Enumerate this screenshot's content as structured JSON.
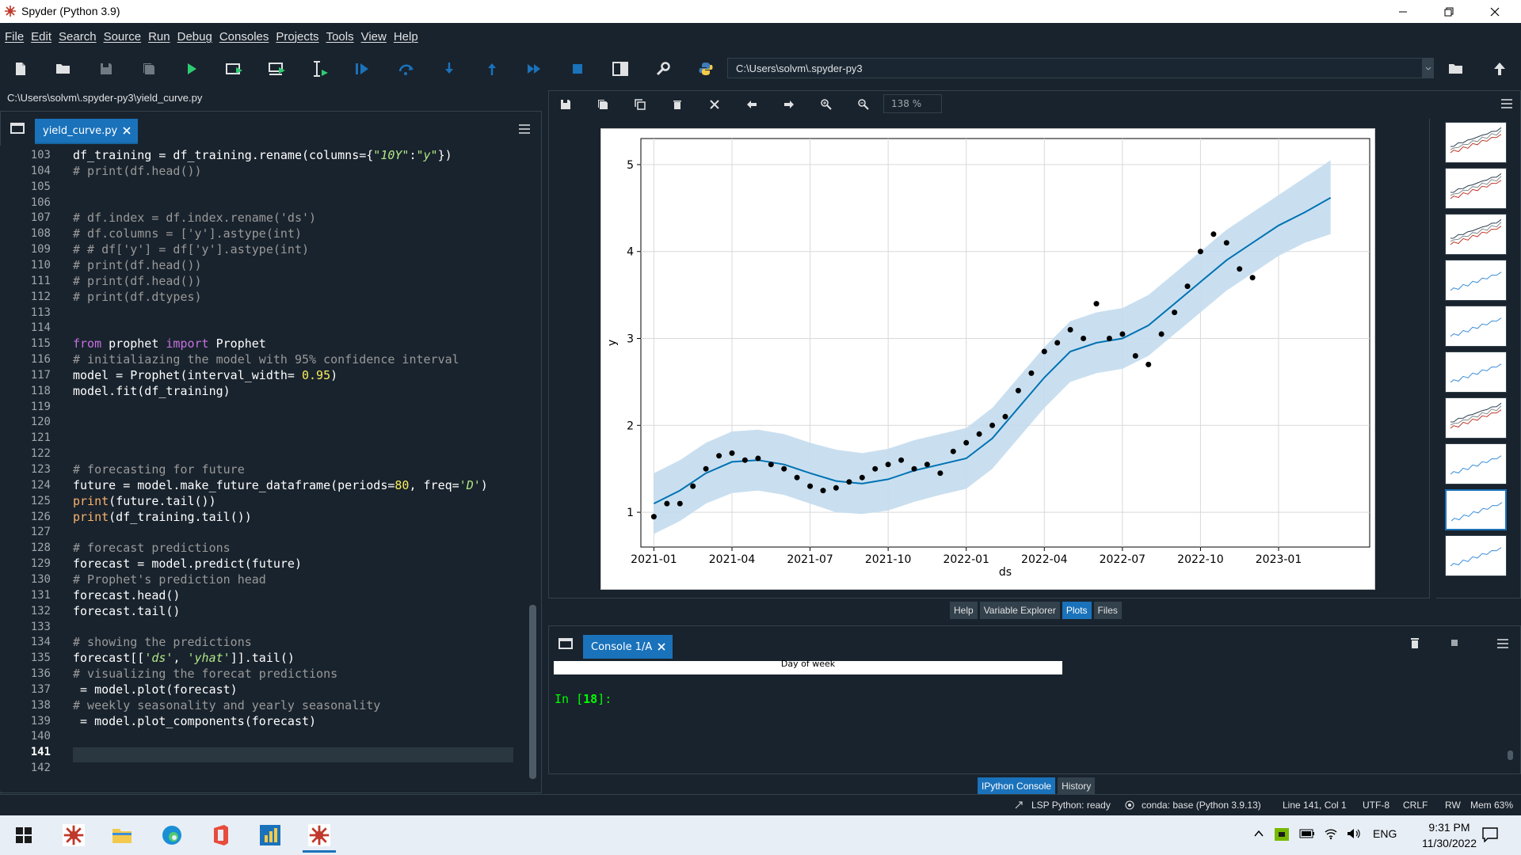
{
  "window": {
    "title": "Spyder (Python 3.9)"
  },
  "menu": [
    "File",
    "Edit",
    "Search",
    "Source",
    "Run",
    "Debug",
    "Consoles",
    "Projects",
    "Tools",
    "View",
    "Help"
  ],
  "toolbar": {
    "working_dir": "C:\\Users\\solvm\\.spyder-py3"
  },
  "editor": {
    "file_path": "C:\\Users\\solvm\\.spyder-py3\\yield_curve.py",
    "tab_label": "yield_curve.py",
    "current_line": 141,
    "lines": [
      {
        "n": "103",
        "t": "df_training = df_training.rename(columns={\"10Y\":\"y\"})"
      },
      {
        "n": "104",
        "t": "# print(df.head())"
      },
      {
        "n": "105",
        "t": ""
      },
      {
        "n": "106",
        "t": ""
      },
      {
        "n": "107",
        "t": "# df.index = df.index.rename('ds')"
      },
      {
        "n": "108",
        "t": "# df.columns = ['y'].astype(int)"
      },
      {
        "n": "109",
        "t": "# # df['y'] = df['y'].astype(int)"
      },
      {
        "n": "110",
        "t": "# print(df.head())"
      },
      {
        "n": "111",
        "t": "# print(df.head())"
      },
      {
        "n": "112",
        "t": "# print(df.dtypes)"
      },
      {
        "n": "113",
        "t": ""
      },
      {
        "n": "114",
        "t": ""
      },
      {
        "n": "115",
        "t": "from prophet import Prophet"
      },
      {
        "n": "116",
        "t": "# initialiazing the model with 95% confidence interval"
      },
      {
        "n": "117",
        "t": "model = Prophet(interval_width= 0.95)"
      },
      {
        "n": "118",
        "t": "model.fit(df_training)"
      },
      {
        "n": "119",
        "t": ""
      },
      {
        "n": "120",
        "t": ""
      },
      {
        "n": "121",
        "t": ""
      },
      {
        "n": "122",
        "t": ""
      },
      {
        "n": "123",
        "t": "# forecasting for future"
      },
      {
        "n": "124",
        "t": "future = model.make_future_dataframe(periods=80, freq='D')"
      },
      {
        "n": "125",
        "t": "print(future.tail())"
      },
      {
        "n": "126",
        "t": "print(df_training.tail())"
      },
      {
        "n": "127",
        "t": ""
      },
      {
        "n": "128",
        "t": "# forecast predictions"
      },
      {
        "n": "129",
        "t": "forecast = model.predict(future)"
      },
      {
        "n": "130",
        "t": "# Prophet's prediction head"
      },
      {
        "n": "131",
        "t": "forecast.head()"
      },
      {
        "n": "132",
        "t": "forecast.tail()"
      },
      {
        "n": "133",
        "t": ""
      },
      {
        "n": "134",
        "t": "# showing the predictions"
      },
      {
        "n": "135",
        "t": "forecast[['ds', 'yhat']].tail()"
      },
      {
        "n": "136",
        "t": "# visualizing the forecat predictions"
      },
      {
        "n": "137",
        "t": "fig1 = model.plot(forecast)"
      },
      {
        "n": "138",
        "t": "# weekly seasonality and yearly seasonality"
      },
      {
        "n": "139",
        "t": "fig2 = model.plot_components(forecast)"
      },
      {
        "n": "140",
        "t": ""
      },
      {
        "n": "141",
        "t": ""
      },
      {
        "n": "142",
        "t": ""
      }
    ]
  },
  "plots": {
    "zoom": "138 %",
    "chart_data": {
      "type": "line",
      "xlabel": "ds",
      "ylabel": "y",
      "x_ticks": [
        "2021-01",
        "2021-04",
        "2021-07",
        "2021-10",
        "2022-01",
        "2022-04",
        "2022-07",
        "2022-10",
        "2023-01"
      ],
      "y_ticks": [
        1,
        2,
        3,
        4,
        5
      ],
      "ylim": [
        0.6,
        5.3
      ],
      "xlim_months": [
        -0.5,
        27.5
      ],
      "grid": true,
      "series": [
        {
          "role": "forecast",
          "color": "#0072b2",
          "x_months": [
            0,
            1,
            2,
            3,
            4,
            5,
            6,
            7,
            8,
            9,
            10,
            11,
            12,
            13,
            14,
            15,
            16,
            17,
            18,
            19,
            20,
            21,
            22,
            23,
            24,
            25,
            26
          ],
          "yhat": [
            1.1,
            1.25,
            1.45,
            1.58,
            1.6,
            1.55,
            1.45,
            1.36,
            1.33,
            1.38,
            1.48,
            1.55,
            1.62,
            1.85,
            2.2,
            2.55,
            2.85,
            2.95,
            3.0,
            3.15,
            3.4,
            3.65,
            3.9,
            4.1,
            4.3,
            4.45,
            4.62
          ],
          "lower": [
            0.75,
            0.9,
            1.1,
            1.22,
            1.25,
            1.2,
            1.1,
            1.0,
            0.98,
            1.02,
            1.12,
            1.2,
            1.27,
            1.5,
            1.85,
            2.2,
            2.5,
            2.6,
            2.65,
            2.8,
            3.05,
            3.3,
            3.55,
            3.75,
            3.95,
            4.1,
            4.2
          ],
          "upper": [
            1.45,
            1.6,
            1.8,
            1.93,
            1.95,
            1.9,
            1.8,
            1.72,
            1.68,
            1.73,
            1.83,
            1.9,
            1.97,
            2.2,
            2.55,
            2.9,
            3.2,
            3.3,
            3.35,
            3.5,
            3.75,
            4.0,
            4.25,
            4.45,
            4.65,
            4.85,
            5.05
          ]
        },
        {
          "role": "observed",
          "color": "#000000",
          "x_months": [
            0,
            0.5,
            1,
            1.5,
            2,
            2.5,
            3,
            3.5,
            4,
            4.5,
            5,
            5.5,
            6,
            6.5,
            7,
            7.5,
            8,
            8.5,
            9,
            9.5,
            10,
            10.5,
            11,
            11.5,
            12,
            12.5,
            13,
            13.5,
            14,
            14.5,
            15,
            15.5,
            16,
            16.5,
            17,
            17.5,
            18,
            18.5,
            19,
            19.5,
            20,
            20.5,
            21,
            21.5,
            22,
            22.5,
            23
          ],
          "y": [
            0.95,
            1.1,
            1.1,
            1.3,
            1.5,
            1.65,
            1.68,
            1.6,
            1.62,
            1.55,
            1.5,
            1.4,
            1.3,
            1.25,
            1.28,
            1.35,
            1.4,
            1.5,
            1.55,
            1.6,
            1.5,
            1.55,
            1.45,
            1.7,
            1.8,
            1.9,
            2.0,
            2.1,
            2.4,
            2.6,
            2.85,
            2.95,
            3.1,
            3.0,
            3.4,
            3.0,
            3.05,
            2.8,
            2.7,
            3.05,
            3.3,
            3.6,
            4.0,
            4.2,
            4.1,
            3.8,
            3.7
          ]
        }
      ]
    }
  },
  "plot_tabs": [
    "Help",
    "Variable Explorer",
    "Plots",
    "Files"
  ],
  "plot_tabs_active": "Plots",
  "console": {
    "tab_label": "Console 1/A",
    "output_snippet": "Day of week",
    "prompt_prefix": "In [",
    "prompt_num": "18",
    "prompt_suffix": "]:"
  },
  "console_tabs": [
    "IPython Console",
    "History"
  ],
  "console_tabs_active": "IPython Console",
  "status": {
    "lsp": "LSP Python: ready",
    "conda": "conda: base (Python 3.9.13)",
    "position": "Line 141, Col 1",
    "encoding": "UTF-8",
    "eol": "CRLF",
    "rw": "RW",
    "mem": "Mem 63%"
  },
  "taskbar": {
    "time": "9:31 PM",
    "date": "11/30/2022",
    "lang": "ENG"
  },
  "colors": {
    "background": "#19232d",
    "accent": "#1a72bb",
    "border": "#32414b",
    "forecast_band": "#c3dbee"
  },
  "icons": {
    "toolbar": [
      "new-file-icon",
      "open-folder-icon",
      "save-icon",
      "save-all-icon",
      "run-icon",
      "run-cell-icon",
      "run-cell-advance-icon",
      "run-selection-icon",
      "debug-icon",
      "step-over-icon",
      "step-into-icon",
      "step-out-icon",
      "continue-icon",
      "stop-icon",
      "maximize-pane-icon",
      "preferences-wrench-icon",
      "python-path-icon"
    ],
    "plot_toolbar": [
      "save-plot-icon",
      "save-all-plots-icon",
      "copy-plot-icon",
      "remove-plot-icon",
      "remove-all-plots-icon",
      "previous-plot-icon",
      "next-plot-icon",
      "zoom-in-icon",
      "zoom-out-icon"
    ]
  }
}
